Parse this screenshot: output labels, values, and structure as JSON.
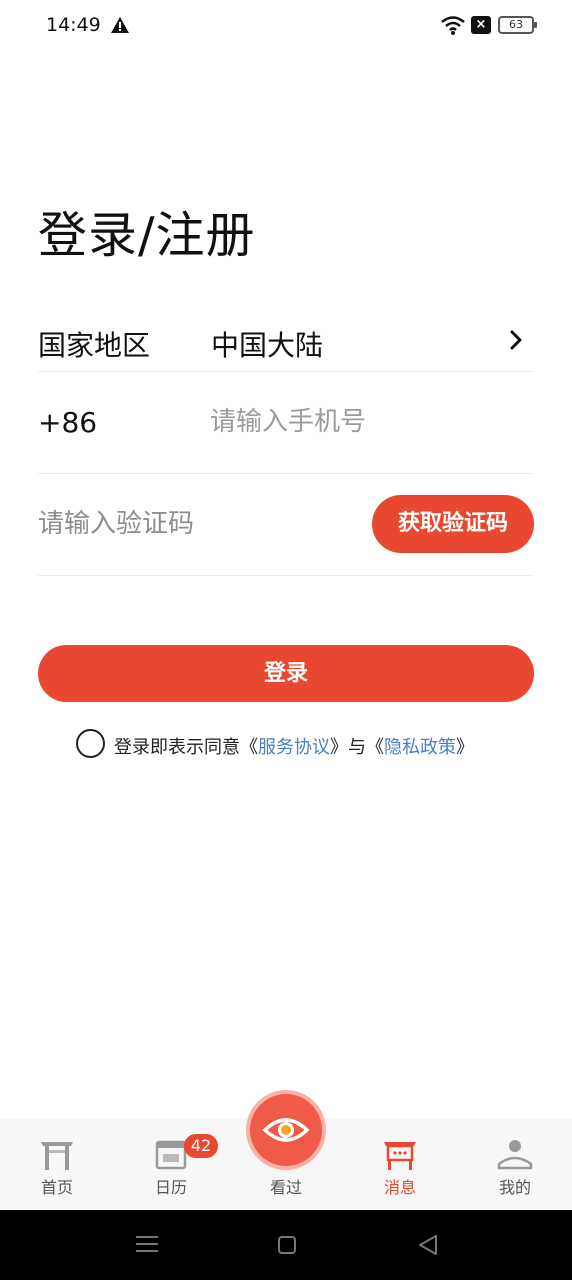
{
  "status_bar": {
    "time": "14:49",
    "battery": "63"
  },
  "title": "登录/注册",
  "region": {
    "label": "国家地区",
    "value": "中国大陆"
  },
  "phone": {
    "country_code": "+86",
    "placeholder": "请输入手机号"
  },
  "code": {
    "placeholder": "请输入验证码",
    "button": "获取验证码"
  },
  "login_button": "登录",
  "agreement": {
    "prefix": "登录即表示同意《",
    "service_link": "服务协议",
    "middle": "》与《",
    "privacy_link": "隐私政策",
    "suffix": "》"
  },
  "tabs": [
    {
      "label": "首页",
      "icon": "home-gate-icon"
    },
    {
      "label": "日历",
      "icon": "calendar-icon",
      "badge": "42"
    },
    {
      "label": "看过",
      "icon": "eye-icon"
    },
    {
      "label": "消息",
      "icon": "message-icon",
      "active": true
    },
    {
      "label": "我的",
      "icon": "profile-icon"
    }
  ],
  "colors": {
    "accent": "#e84730",
    "link": "#4a7fc0"
  }
}
